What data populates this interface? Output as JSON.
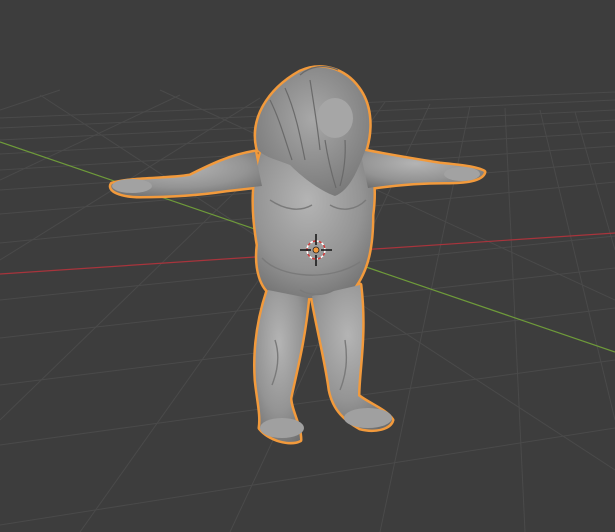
{
  "viewport": {
    "background_color": "#3d3d3d",
    "grid_line_color": "#4a4a4a",
    "x_axis_color": "#a8343c",
    "y_axis_color": "#6e9a3a",
    "selection_outline_color": "#f29a3c",
    "mesh_color": "#9a9a9a",
    "origin_icon": "3d-cursor-icon"
  }
}
